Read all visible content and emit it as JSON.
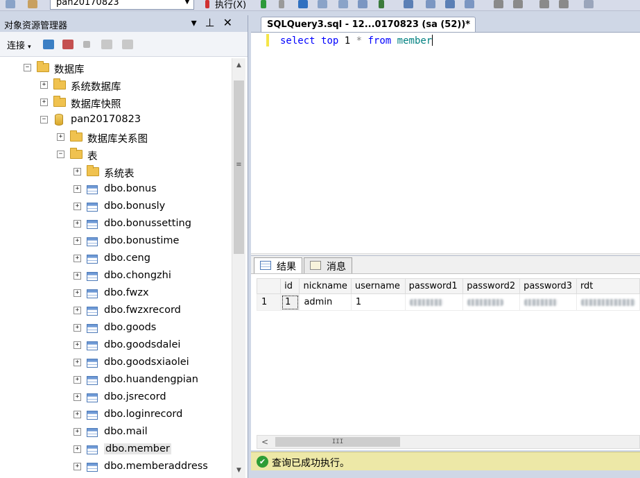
{
  "toolbar": {
    "database": "pan20170823",
    "execute_label": "执行(X)"
  },
  "object_explorer": {
    "title": "对象资源管理器",
    "connect_label": "连接",
    "tree": [
      {
        "label": "数据库",
        "kind": "folder",
        "expander": "−",
        "indent": 0
      },
      {
        "label": "系统数据库",
        "kind": "folder",
        "expander": "+",
        "indent": 1
      },
      {
        "label": "数据库快照",
        "kind": "folder",
        "expander": "+",
        "indent": 1
      },
      {
        "label": "pan20170823",
        "kind": "database",
        "expander": "−",
        "indent": 1
      },
      {
        "label": "数据库关系图",
        "kind": "folder",
        "expander": "+",
        "indent": 2
      },
      {
        "label": "表",
        "kind": "folder",
        "expander": "−",
        "indent": 2
      },
      {
        "label": "系统表",
        "kind": "folder",
        "expander": "+",
        "indent": 3
      },
      {
        "label": "dbo.bonus",
        "kind": "table",
        "expander": "+",
        "indent": 3
      },
      {
        "label": "dbo.bonusly",
        "kind": "table",
        "expander": "+",
        "indent": 3
      },
      {
        "label": "dbo.bonussetting",
        "kind": "table",
        "expander": "+",
        "indent": 3
      },
      {
        "label": "dbo.bonustime",
        "kind": "table",
        "expander": "+",
        "indent": 3
      },
      {
        "label": "dbo.ceng",
        "kind": "table",
        "expander": "+",
        "indent": 3
      },
      {
        "label": "dbo.chongzhi",
        "kind": "table",
        "expander": "+",
        "indent": 3
      },
      {
        "label": "dbo.fwzx",
        "kind": "table",
        "expander": "+",
        "indent": 3
      },
      {
        "label": "dbo.fwzxrecord",
        "kind": "table",
        "expander": "+",
        "indent": 3
      },
      {
        "label": "dbo.goods",
        "kind": "table",
        "expander": "+",
        "indent": 3
      },
      {
        "label": "dbo.goodsdalei",
        "kind": "table",
        "expander": "+",
        "indent": 3
      },
      {
        "label": "dbo.goodsxiaolei",
        "kind": "table",
        "expander": "+",
        "indent": 3
      },
      {
        "label": "dbo.huandengpian",
        "kind": "table",
        "expander": "+",
        "indent": 3
      },
      {
        "label": "dbo.jsrecord",
        "kind": "table",
        "expander": "+",
        "indent": 3
      },
      {
        "label": "dbo.loginrecord",
        "kind": "table",
        "expander": "+",
        "indent": 3
      },
      {
        "label": "dbo.mail",
        "kind": "table",
        "expander": "+",
        "indent": 3
      },
      {
        "label": "dbo.member",
        "kind": "table",
        "expander": "+",
        "indent": 3,
        "selected": true
      },
      {
        "label": "dbo.memberaddress",
        "kind": "table",
        "expander": "+",
        "indent": 3
      }
    ]
  },
  "query": {
    "tab_title": "SQLQuery3.sql - 12...0170823 (sa (52))*",
    "sql": {
      "kw_select": "select",
      "kw_top": "top",
      "num": "1",
      "star": "*",
      "kw_from": "from",
      "table": "member"
    }
  },
  "results": {
    "tab_results": "结果",
    "tab_messages": "消息",
    "columns": [
      "id",
      "nickname",
      "username",
      "password1",
      "password2",
      "password3",
      "rdt"
    ],
    "rows": [
      {
        "row_number": "1",
        "id": "1",
        "nickname": "admin",
        "username": "1"
      }
    ]
  },
  "status": {
    "text": "查询已成功执行。",
    "color": "#ede8a7"
  }
}
